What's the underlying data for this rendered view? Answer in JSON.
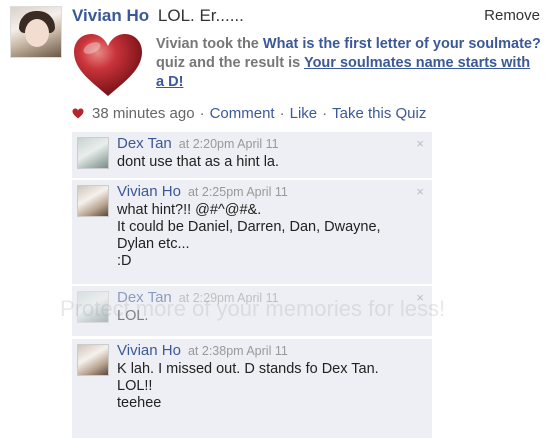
{
  "post": {
    "author": "Vivian Ho",
    "status": "LOL. Er......",
    "remove_label": "Remove",
    "quiz_prefix": "Vivian took the ",
    "quiz_title": "What is the first letter of your soulmate?",
    "quiz_middle": " quiz and the result is ",
    "quiz_result": "Your soulmates name starts with a D!",
    "timestamp": "38 minutes ago",
    "comment_link": "Comment",
    "like_link": "Like",
    "take_quiz_link": "Take this Quiz",
    "separator": "·"
  },
  "comments": [
    {
      "author": "Dex Tan",
      "time": "at 2:20pm April 11",
      "text": "dont use that as a hint la.",
      "close": "×"
    },
    {
      "author": "Vivian Ho",
      "time": "at 2:25pm April 11",
      "text": "what hint?!! @#^@#&.\nIt could be Daniel, Darren, Dan, Dwayne, Dylan etc...\n:D",
      "close": "×"
    },
    {
      "author": "Dex Tan",
      "time": "at 2:29pm April 11",
      "text": "LOL.",
      "close": "×"
    },
    {
      "author": "Vivian Ho",
      "time": "at 2:38pm April 11",
      "text": "K lah. I missed out. D stands fo Dex Tan.\nLOL!!\nteehee",
      "close": ""
    }
  ],
  "watermark": "Protect more of your memories for less!",
  "colors": {
    "link": "#3b5998",
    "comment_bg": "#edeff4",
    "heart": "#b3262b"
  },
  "icons": {
    "post_icon": "heart-icon",
    "meta_icon": "heart-icon",
    "close_icon": "close-icon"
  }
}
